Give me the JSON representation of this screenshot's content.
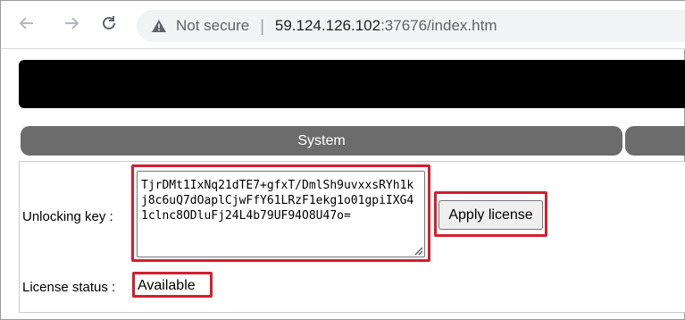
{
  "browser": {
    "security_label": "Not secure",
    "separator": "|",
    "url_host": "59.124.126.102",
    "url_rest": ":37676/index.htm",
    "icons": [
      "back-arrow-icon",
      "forward-arrow-icon",
      "reload-icon",
      "warning-icon"
    ]
  },
  "nav": {
    "tabs": [
      {
        "label": "System"
      },
      {
        "label": ""
      }
    ]
  },
  "license": {
    "unlock_label": "Unlocking key :",
    "unlock_value": "TjrDMt1IxNq21dTE7+gfxT/DmlSh9uvxxsRYh1kj8c6uQ7dOaplCjwFfY61LRzF1ekg1o01gpiIXG41clnc8ODluFj24L4b79UF94O8U47o=",
    "apply_label": "Apply license",
    "status_label": "License status :",
    "status_value": "Available"
  },
  "colors": {
    "highlight": "#d31f2e",
    "tab_bg": "#6c6c6c",
    "banner_bg": "#000000"
  }
}
